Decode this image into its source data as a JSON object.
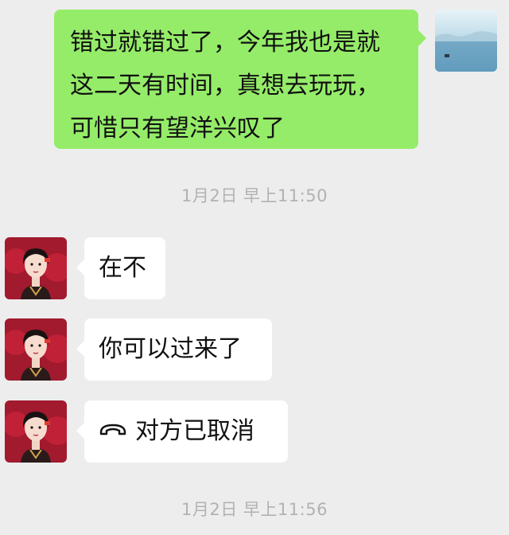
{
  "messages": {
    "sent": {
      "line1": "错过就错过了，今年我也是就",
      "line2": "这二天有时间，真想去玩玩，",
      "line3": "可惜只有望洋兴叹了"
    },
    "timestamp1": "1月2日 早上11:50",
    "recv1": "在不",
    "recv2": "你可以过来了",
    "call_status": "对方已取消",
    "call_icon": "phone-hangup-icon",
    "timestamp2": "1月2日 早上11:56"
  },
  "colors": {
    "background": "#ededed",
    "sent_bubble": "#95ec69",
    "recv_bubble": "#ffffff",
    "timestamp_text": "#b2b2b2"
  }
}
